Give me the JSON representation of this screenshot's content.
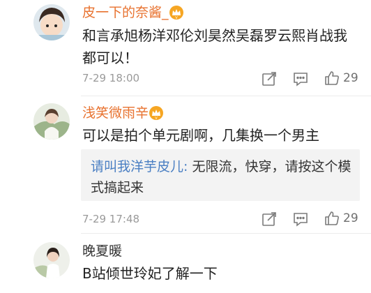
{
  "comments": [
    {
      "username": "皮一下的奈酱_",
      "text_line1": "和言承旭杨洋邓伦刘昊然吴磊罗云熙肖战我",
      "text_line2": "都可以！",
      "time": "7-29 18:00",
      "likes": "29"
    },
    {
      "username": "浅笑微雨辛",
      "text": "可以是拍个单元剧啊，几集换一个男主",
      "reply": {
        "user": "请叫我洋芋皮儿:",
        "text_part1": " 无限流，快穿，请按这个模",
        "text_part2": "式搞起来"
      },
      "time": "7-29 17:48",
      "likes": "29"
    },
    {
      "username": "晚夏暖",
      "text": "B站倾世玲妃了解一下"
    }
  ],
  "icons": {
    "repost": "repost-icon",
    "comment": "comment-icon",
    "like": "thumbs-up-icon",
    "vip": "vip-crown-icon"
  },
  "colors": {
    "vip_name": "#e8722f",
    "reply_user": "#4a7fc3",
    "meta": "#9a9a9a"
  }
}
